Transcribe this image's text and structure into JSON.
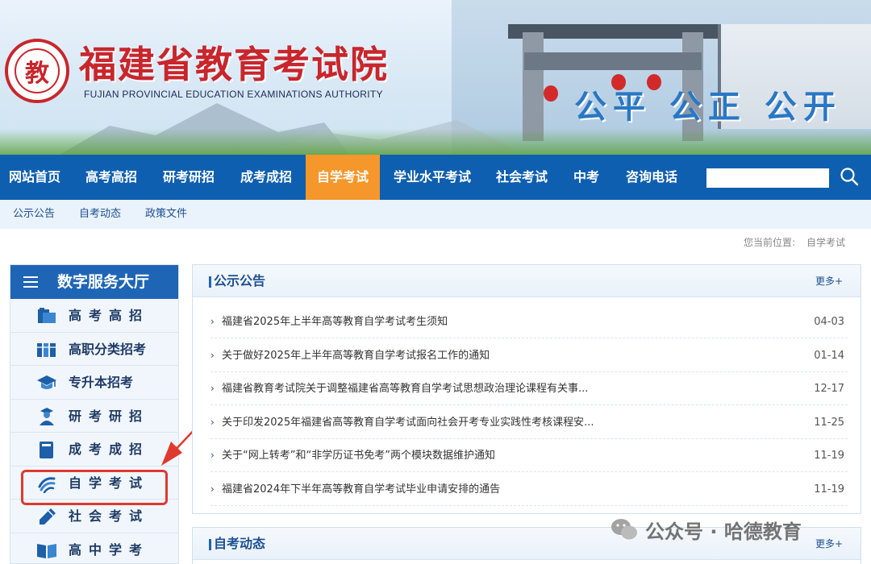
{
  "header": {
    "title": "福建省教育考试院",
    "subtitle": "FUJIAN PROVINCIAL EDUCATION EXAMINATIONS AUTHORITY",
    "slogan": "公平 公正 公开"
  },
  "nav": {
    "items": [
      {
        "label": "网站首页",
        "active": false
      },
      {
        "label": "高考高招",
        "active": false
      },
      {
        "label": "研考研招",
        "active": false
      },
      {
        "label": "成考成招",
        "active": false
      },
      {
        "label": "自学考试",
        "active": true
      },
      {
        "label": "学业水平考试",
        "active": false
      },
      {
        "label": "社会考试",
        "active": false
      },
      {
        "label": "中考",
        "active": false
      },
      {
        "label": "咨询电话",
        "active": false
      }
    ],
    "search_value": ""
  },
  "subnav": {
    "items": [
      "公示公告",
      "自考动态",
      "政策文件"
    ]
  },
  "location": {
    "label": "您当前位置:",
    "value": "自学考试"
  },
  "sidebar": {
    "title": "数字服务大厅",
    "items": [
      {
        "label": "高考高招",
        "icon": "book-stack-icon"
      },
      {
        "label": "高职分类招考",
        "icon": "books-icon"
      },
      {
        "label": "专升本招考",
        "icon": "graduation-cap-icon"
      },
      {
        "label": "研考研招",
        "icon": "graduate-icon"
      },
      {
        "label": "成考成招",
        "icon": "book-icon"
      },
      {
        "label": "自学考试",
        "icon": "swirl-logo-icon"
      },
      {
        "label": "社会考试",
        "icon": "pen-icon"
      },
      {
        "label": "高中学考",
        "icon": "open-book-icon"
      }
    ]
  },
  "panels": {
    "notices": {
      "title": "公示公告",
      "more": "更多+",
      "items": [
        {
          "title": "福建省2025年上半年高等教育自学考试考生须知",
          "date": "04-03"
        },
        {
          "title": "关于做好2025年上半年高等教育自学考试报名工作的通知",
          "date": "01-14"
        },
        {
          "title": "福建省教育考试院关于调整福建省高等教育自学考试思想政治理论课程有关事...",
          "date": "12-17"
        },
        {
          "title": "关于印发2025年福建省高等教育自学考试面向社会开考专业实践性考核课程安...",
          "date": "11-25"
        },
        {
          "title": "关于“网上转考”和“非学历证书免考”两个模块数据维护通知",
          "date": "11-19"
        },
        {
          "title": "福建省2024年下半年高等教育自学考试毕业申请安排的通告",
          "date": "11-19"
        }
      ]
    },
    "news": {
      "title": "自考动态",
      "more": "更多+"
    }
  },
  "watermark": {
    "text": "公众号 · 哈德教育"
  },
  "colors": {
    "nav_bg": "#0f5fb0",
    "nav_active": "#f5972a",
    "brand_red": "#c8262c",
    "annotation_red": "#e0392e"
  }
}
